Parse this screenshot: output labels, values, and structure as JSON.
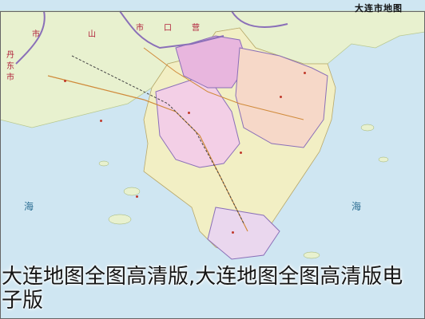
{
  "map": {
    "title": "大连市地图",
    "border_labels": {
      "left_top": "丹",
      "left_mid": "东",
      "left_low": "市",
      "top_a": "市",
      "top_b": "山",
      "top_c": "市",
      "top_d": "口",
      "top_e": "营"
    },
    "sea_labels": {
      "left": "海",
      "right": "海"
    },
    "caption": "大连地图全图高清版,大连地图全图高清版电子版",
    "colors": {
      "sea": "#cfe6f2",
      "land_green": "#e8f1cf",
      "land_pink": "#f3cfe6",
      "land_magenta": "#e8b6de",
      "land_peach": "#f6d8c8",
      "land_yellow": "#f2efc4",
      "border": "#8a6fb8",
      "road": "#d08a3a",
      "rail": "#444444"
    }
  }
}
